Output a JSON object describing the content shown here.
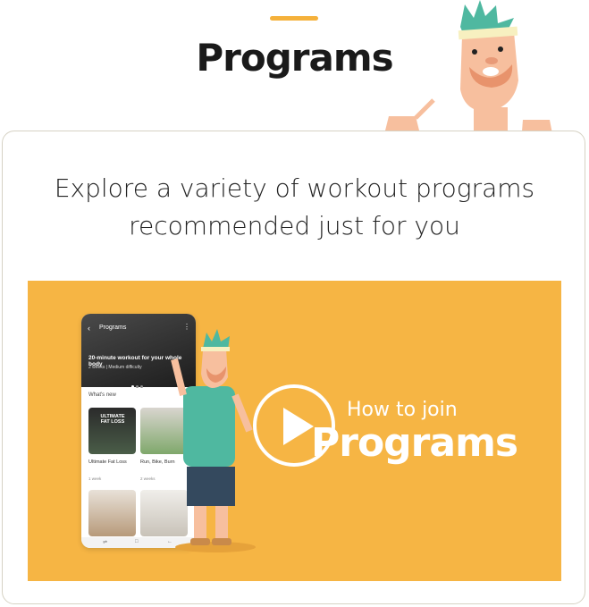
{
  "header": {
    "title": "Programs"
  },
  "card": {
    "subtitle_line1": "Explore a variety of workout programs",
    "subtitle_line2": "recommended just for you"
  },
  "video": {
    "how_to": "How to join",
    "title": "Programs",
    "phone": {
      "header_title": "Programs",
      "hero_title": "20-minute workout for your whole body",
      "hero_meta": "2 weeks | Medium difficulty",
      "section": "What's new",
      "tile1_badge": "ULTIMATE FAT LOSS",
      "tile1_label": "Ultimate Fat Loss",
      "tile1_duration": "1 week",
      "tile2_label": "Run, Bike, Burn",
      "tile2_duration": "2 weeks"
    }
  },
  "colors": {
    "accent": "#f5b13b",
    "video_bg": "#f6b544",
    "card_border": "#d6d2c4"
  }
}
